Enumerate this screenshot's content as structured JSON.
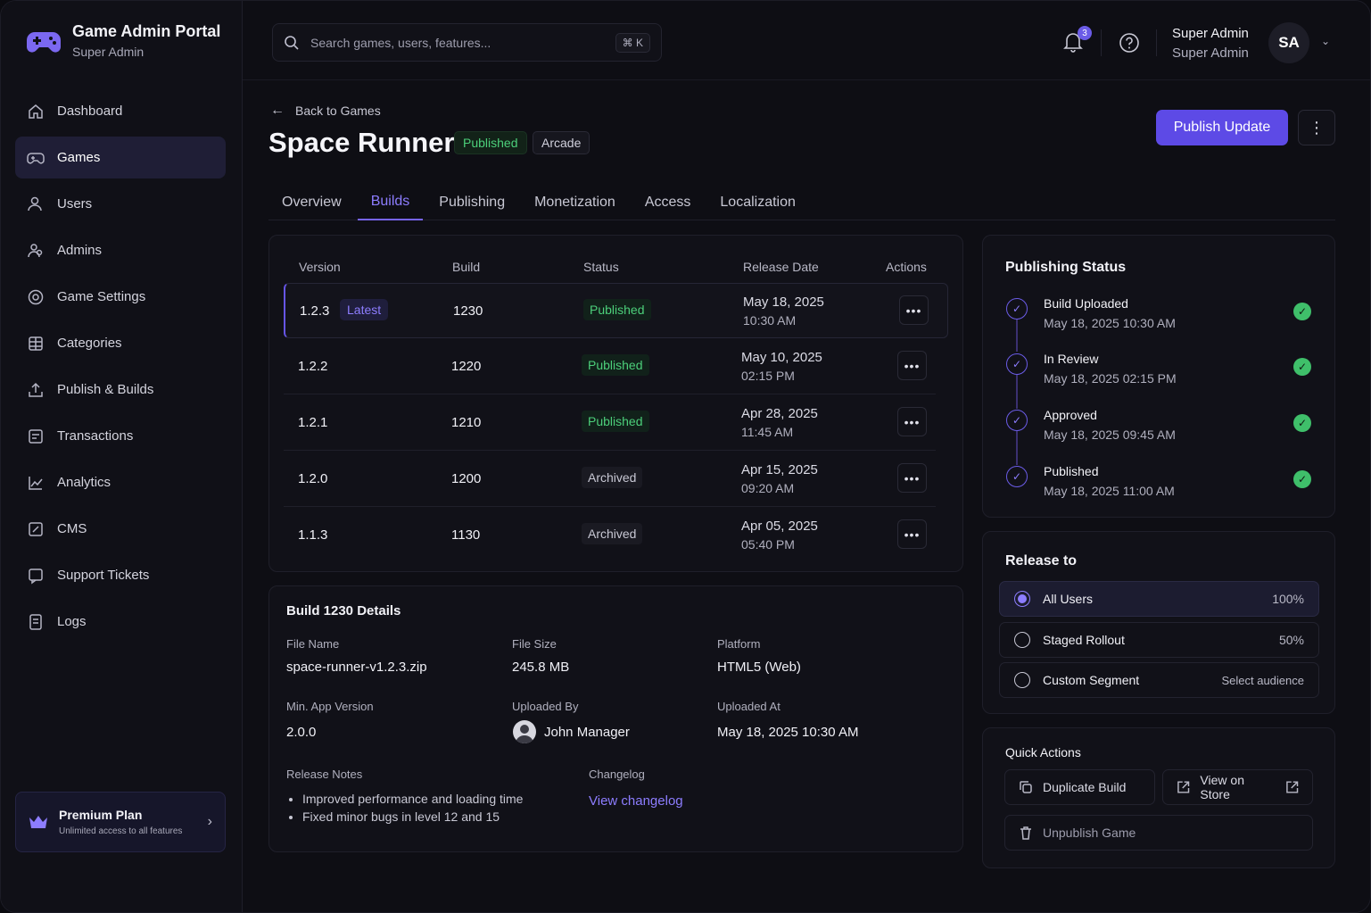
{
  "brand": {
    "title": "Game Admin Portal",
    "subtitle": "Super Admin"
  },
  "sidebar": {
    "items": [
      {
        "label": "Dashboard",
        "icon": "home-icon"
      },
      {
        "label": "Games",
        "icon": "gamepad-icon",
        "active": true
      },
      {
        "label": "Users",
        "icon": "user-icon"
      },
      {
        "label": "Admins",
        "icon": "users-icon"
      },
      {
        "label": "Game Settings",
        "icon": "gear-icon"
      },
      {
        "label": "Categories",
        "icon": "grid-icon"
      },
      {
        "label": "Publish & Builds",
        "icon": "upload-icon"
      },
      {
        "label": "Transactions",
        "icon": "receipt-icon"
      },
      {
        "label": "Analytics",
        "icon": "chart-icon"
      },
      {
        "label": "CMS",
        "icon": "edit-icon"
      },
      {
        "label": "Support Tickets",
        "icon": "ticket-icon"
      },
      {
        "label": "Logs",
        "icon": "file-icon"
      }
    ],
    "premium": {
      "title": "Premium Plan",
      "subtitle": "Unlimited access to all features"
    }
  },
  "topbar": {
    "search_placeholder": "Search games, users, features...",
    "shortcut": "⌘ K",
    "notification_count": "3",
    "user_name": "Super Admin",
    "user_role": "Super Admin",
    "avatar_initials": "SA"
  },
  "header": {
    "back_label": "Back to Games",
    "title": "Space Runner",
    "status_tag": "Published",
    "genre_tag": "Arcade",
    "publish_button": "Publish Update"
  },
  "tabs": [
    "Overview",
    "Builds",
    "Publishing",
    "Monetization",
    "Access",
    "Localization"
  ],
  "active_tab": "Builds",
  "builds_table": {
    "columns": [
      "Version",
      "Build",
      "Status",
      "Release Date",
      "Actions"
    ],
    "latest_label": "Latest",
    "rows": [
      {
        "version": "1.2.3",
        "build": "1230",
        "status": "Published",
        "date": "May 18, 2025",
        "time": "10:30 AM"
      },
      {
        "version": "1.2.2",
        "build": "1220",
        "status": "Published",
        "date": "May 10, 2025",
        "time": "02:15 PM"
      },
      {
        "version": "1.2.1",
        "build": "1210",
        "status": "Published",
        "date": "Apr 28, 2025",
        "time": "11:45 AM"
      },
      {
        "version": "1.2.0",
        "build": "1200",
        "status": "Archived",
        "date": "Apr 15, 2025",
        "time": "09:20 AM"
      },
      {
        "version": "1.1.3",
        "build": "1130",
        "status": "Archived",
        "date": "Apr 05, 2025",
        "time": "05:40 PM"
      }
    ]
  },
  "details": {
    "title": "Build 1230 Details",
    "file_name_label": "File Name",
    "file_name": "space-runner-v1.2.3.zip",
    "file_size_label": "File Size",
    "file_size": "245.8 MB",
    "platform_label": "Platform",
    "platform": "HTML5 (Web)",
    "min_app_label": "Min. App Version",
    "min_app": "2.0.0",
    "uploaded_by_label": "Uploaded By",
    "uploaded_by": "John Manager",
    "uploaded_at_label": "Uploaded At",
    "uploaded_at": "May 18, 2025 10:30 AM",
    "release_notes_label": "Release Notes",
    "release_notes": [
      "Improved performance and loading time",
      "Fixed minor bugs in level 12 and 15"
    ],
    "changelog_label": "Changelog",
    "changelog_link": "View changelog"
  },
  "publishing_status": {
    "title": "Publishing Status",
    "steps": [
      {
        "title": "Build Uploaded",
        "date": "May 18, 2025 10:30 AM"
      },
      {
        "title": "In Review",
        "date": "May 18, 2025 02:15 PM"
      },
      {
        "title": "Approved",
        "date": "May 18, 2025 09:45 AM"
      },
      {
        "title": "Published",
        "date": "May 18, 2025 11:00 AM"
      }
    ]
  },
  "release_to": {
    "title": "Release to",
    "options": [
      {
        "label": "All Users",
        "value": "100%",
        "selected": true
      },
      {
        "label": "Staged Rollout",
        "value": "50%",
        "selected": false
      },
      {
        "label": "Custom Segment",
        "value": "Select audience",
        "selected": false
      }
    ]
  },
  "quick_actions": {
    "title": "Quick Actions",
    "duplicate": "Duplicate Build",
    "view_store": "View on Store",
    "unpublish": "Unpublish Game"
  },
  "colors": {
    "accent": "#5d4ae6",
    "success": "#3fbf6a",
    "background": "#0e0e14"
  }
}
